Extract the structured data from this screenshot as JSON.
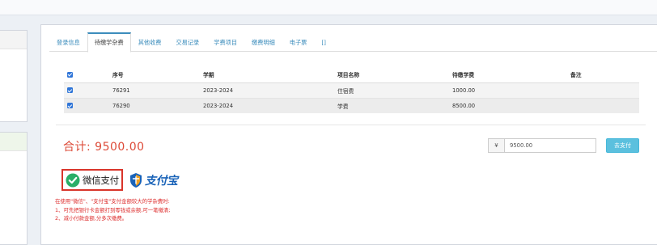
{
  "tabs": [
    {
      "label": "登录信息",
      "active": false
    },
    {
      "label": "待缴学杂费",
      "active": true
    },
    {
      "label": "其他收费",
      "active": false
    },
    {
      "label": "交易记录",
      "active": false
    },
    {
      "label": "学费项目",
      "active": false
    },
    {
      "label": "缴费明细",
      "active": false
    },
    {
      "label": "电子票",
      "active": false
    },
    {
      "label": "[]",
      "active": false
    }
  ],
  "table": {
    "headers": [
      "序号",
      "学期",
      "项目名称",
      "待缴学费",
      "备注"
    ],
    "rows": [
      {
        "checked": true,
        "no": "76291",
        "term": "2023-2024",
        "item": "住宿费",
        "fee": "1000.00",
        "note": ""
      },
      {
        "checked": true,
        "no": "76290",
        "term": "2023-2024",
        "item": "学费",
        "fee": "8500.00",
        "note": ""
      }
    ]
  },
  "total": {
    "text": "合计: 9500.00"
  },
  "payment": {
    "currency_symbol": "¥",
    "amount": "9500.00",
    "pay_button": "去支付"
  },
  "logos": {
    "wechat_pay": "微信支付",
    "alipay": "支付宝"
  },
  "notes": {
    "line1": "在使用\"微信\"、\"支付宝\"支付金额较大的学杂费时:",
    "line2": "1、可先把银行卡金额打到零钱或余额,可一笔缴清;",
    "line3": "2、减小付款金额,分多次缴费。"
  },
  "colors": {
    "accent": "#3c8dbc",
    "total_red": "#dd4b39",
    "pay_button": "#5bc0de",
    "checkbox_blue": "#2f75d8",
    "alipay_blue": "#1a63b8",
    "wechat_green": "#2aae67"
  }
}
